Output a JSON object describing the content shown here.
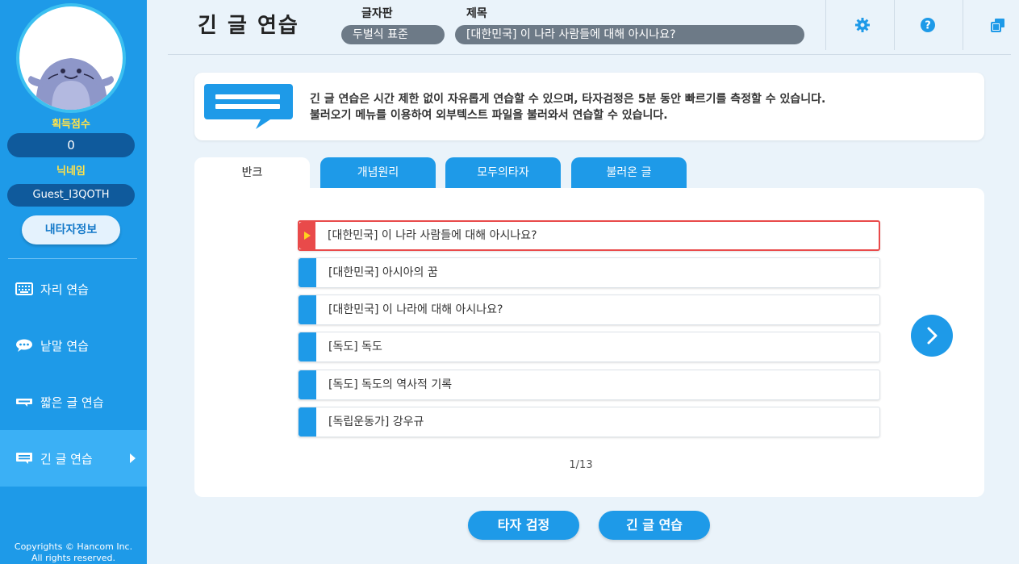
{
  "sidebar": {
    "score_label": "획득점수",
    "score_value": "0",
    "nickname_label": "닉네임",
    "nickname_value": "Guest_I3QOTH",
    "myinfo_button": "내타자정보",
    "menu": [
      {
        "label": "자리 연습",
        "icon": "keyboard-icon"
      },
      {
        "label": "낱말 연습",
        "icon": "speech-bubble-icon"
      },
      {
        "label": "짧은 글 연습",
        "icon": "short-text-icon"
      },
      {
        "label": "긴 글 연습",
        "icon": "long-text-icon",
        "active": true
      }
    ],
    "copyright_line1": "Copyrights © Hancom Inc.",
    "copyright_line2": "All rights reserved."
  },
  "header": {
    "title": "긴 글 연습",
    "keyboard_label": "글자판",
    "keyboard_value": "두벌식 표준",
    "subject_label": "제목",
    "subject_value": "[대한민국] 이 나라 사람들에 대해 아시나요?",
    "icons": [
      "gear-icon",
      "help-icon",
      "window-icon"
    ]
  },
  "info": {
    "line1": "긴 글 연습은 시간 제한 없이 자유롭게 연습할 수 있으며, 타자검정은 5분 동안 빠르기를 측정할 수 있습니다.",
    "line2": "불러오기 메뉴를 이용하여 외부텍스트 파일을 불러와서 연습할 수 있습니다."
  },
  "tabs": [
    {
      "label": "반크",
      "active": true
    },
    {
      "label": "개념원리"
    },
    {
      "label": "모두의타자"
    },
    {
      "label": "불러온 글"
    }
  ],
  "list": [
    {
      "label": "[대한민국] 이 나라 사람들에 대해 아시나요?",
      "selected": true
    },
    {
      "label": "[대한민국] 아시아의 꿈"
    },
    {
      "label": "[대한민국] 이 나라에 대해 아시나요?"
    },
    {
      "label": "[독도] 독도"
    },
    {
      "label": "[독도] 독도의 역사적 기록"
    },
    {
      "label": "[독립운동가] 강우규"
    }
  ],
  "pager": "1/13",
  "buttons": {
    "test": "타자 검정",
    "practice": "긴 글 연습"
  },
  "colors": {
    "sidebar": "#1e9ae8",
    "accent_yellow": "#ffe24a",
    "selected_border": "#e94a4a",
    "background": "#eaf3fa"
  }
}
